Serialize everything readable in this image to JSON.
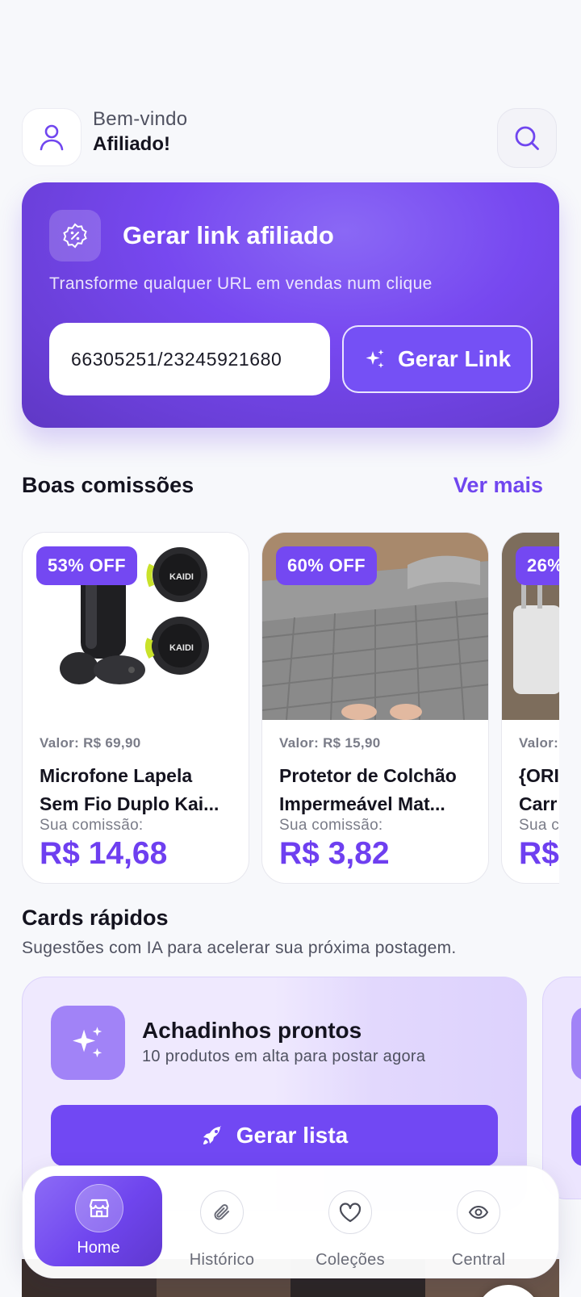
{
  "header": {
    "greeting": "Bem-vindo",
    "user_name": "Afiliado!"
  },
  "hero": {
    "title": "Gerar link afiliado",
    "subtitle": "Transforme qualquer URL em vendas num clique",
    "url_value": "66305251/23245921680",
    "button_label": "Gerar Link"
  },
  "commissions": {
    "title": "Boas comissões",
    "see_more": "Ver mais",
    "products": [
      {
        "badge": "53% OFF",
        "value": "Valor: R$ 69,90",
        "name_line1": "Microfone Lapela",
        "name_line2": "Sem Fio Duplo Kai...",
        "commission_label": "Sua comissão:",
        "commission": "R$ 14,68"
      },
      {
        "badge": "60% OFF",
        "value": "Valor: R$ 15,90",
        "name_line1": "Protetor de Colchão",
        "name_line2": "Impermeável Mat...",
        "commission_label": "Sua comissão:",
        "commission": "R$ 3,82"
      },
      {
        "badge": "26%",
        "value": "Valor:",
        "name_line1": "{ORI",
        "name_line2": "Carr",
        "commission_label": "Sua c",
        "commission": "R$"
      }
    ]
  },
  "quick_cards": {
    "title": "Cards rápidos",
    "subtitle": "Sugestões com IA para acelerar sua próxima postagem.",
    "card": {
      "title": "Achadinhos prontos",
      "subtitle": "10 produtos em alta para postar agora",
      "button_label": "Gerar lista"
    }
  },
  "nav": {
    "items": [
      {
        "label": "Home",
        "icon": "store-icon"
      },
      {
        "label": "Histórico",
        "icon": "paperclip-icon"
      },
      {
        "label": "Coleções",
        "icon": "heart-icon"
      },
      {
        "label": "Central",
        "icon": "eye-icon"
      }
    ]
  },
  "colors": {
    "accent": "#7148f3",
    "accent_text": "#6e3ff0",
    "background": "#f7f8fb"
  }
}
